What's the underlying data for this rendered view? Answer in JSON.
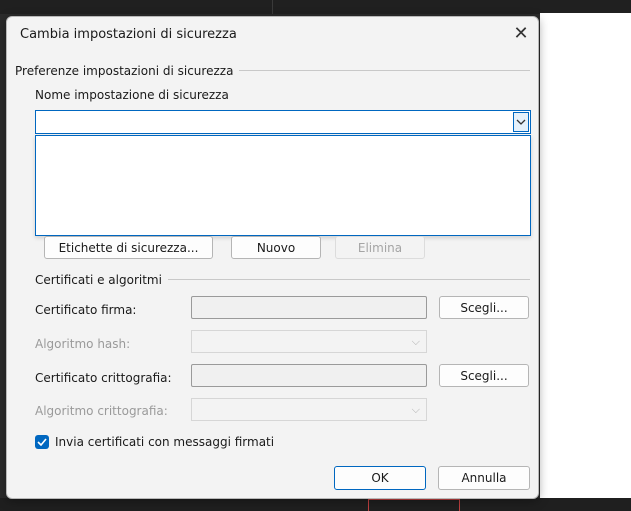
{
  "dialog": {
    "title": "Cambia impostazioni di sicurezza",
    "close_icon": "close-icon"
  },
  "security_prefs": {
    "group_title": "Preferenze impostazioni di sicurezza",
    "name_label": "Nome impostazione di sicurezza",
    "name_value": "",
    "buttons": {
      "labels": "Etichette di sicurezza...",
      "new": "Nuovo",
      "delete": "Elimina"
    }
  },
  "certs": {
    "group_title": "Certificati e algoritmi",
    "signing_cert_label": "Certificato firma:",
    "signing_cert_value": "",
    "choose1": "Scegli...",
    "hash_label": "Algoritmo hash:",
    "encryption_cert_label": "Certificato crittografia:",
    "encryption_cert_value": "",
    "choose2": "Scegli...",
    "encryption_alg_label": "Algoritmo crittografia:"
  },
  "options": {
    "send_certs_label": "Invia certificati con messaggi firmati",
    "send_certs_checked": true
  },
  "footer": {
    "ok": "OK",
    "cancel": "Annulla"
  },
  "colors": {
    "accent": "#0067c0",
    "dialog_bg": "#f3f3f3"
  }
}
